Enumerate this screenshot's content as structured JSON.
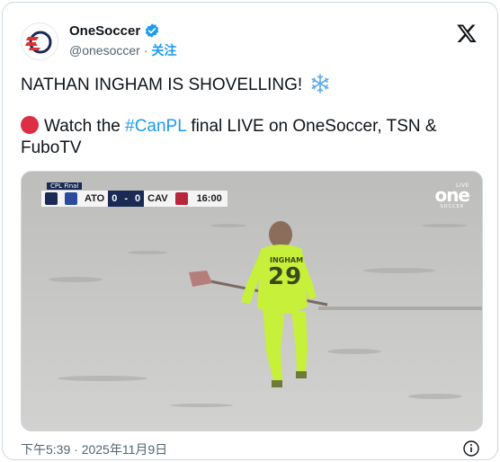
{
  "account": {
    "display_name": "OneSoccer",
    "handle": "@onesoccer",
    "separator": "·",
    "follow_label": "关注"
  },
  "tweet": {
    "line1": "NATHAN INGHAM IS SHOVELLING!",
    "line2_prefix": "Watch the ",
    "hashtag": "#CanPL",
    "line2_suffix": " final LIVE on OneSoccer, TSN &",
    "line3": "FuboTV",
    "emoji_line1": "snowflake-emoji",
    "emoji_line2": "red-circle-emoji"
  },
  "media": {
    "scorebug": {
      "label": "CPL Final",
      "home_team": "ATO",
      "home_score": "0",
      "score_separator": "-",
      "away_score": "0",
      "away_team": "CAV",
      "clock": "16:00"
    },
    "broadcaster": {
      "live_tag": "LIVE",
      "logo_text": "one",
      "logo_sub": "SOCCER"
    },
    "player": {
      "name": "INGHAM",
      "number": "29"
    }
  },
  "footer": {
    "timestamp": "下午5:39 · 2025年11月9日"
  },
  "colors": {
    "link": "#1d9bf0",
    "text": "#0f1419",
    "muted": "#536471",
    "keeper_kit": "#c6f03a",
    "snow": "#c9c9c7"
  },
  "icons": [
    "onesoccer-logo-icon",
    "verified-badge-icon",
    "x-logo-icon",
    "info-icon"
  ]
}
